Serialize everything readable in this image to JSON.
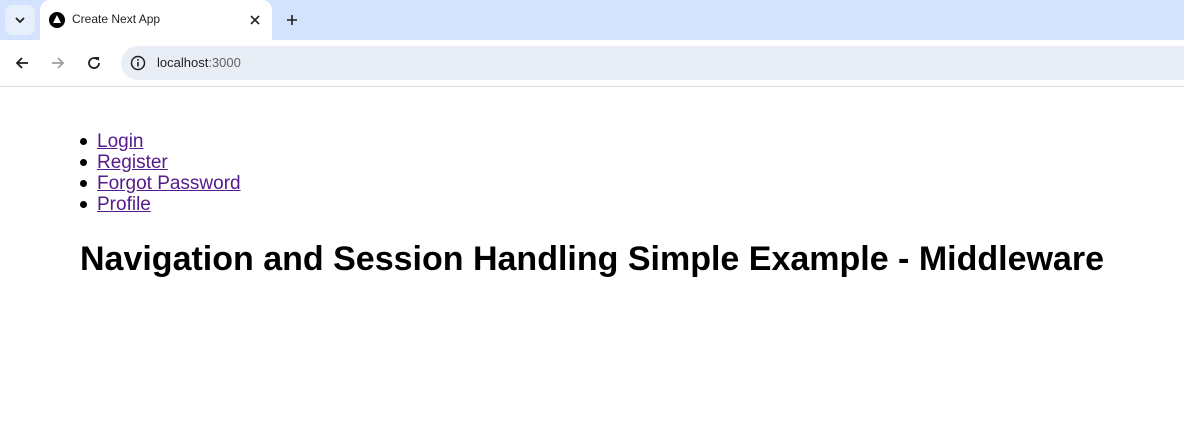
{
  "browser": {
    "tab": {
      "title": "Create Next App"
    },
    "address_bar": {
      "host": "localhost",
      "port": ":3000"
    }
  },
  "page": {
    "nav_links": [
      {
        "label": "Login"
      },
      {
        "label": "Register"
      },
      {
        "label": "Forgot Password"
      },
      {
        "label": "Profile"
      }
    ],
    "title": "Navigation and Session Handling Simple Example - Middleware"
  },
  "icons": {
    "tab_search": "chevron-down-icon",
    "favicon": "nextjs-favicon-icon",
    "tab_close": "close-icon",
    "new_tab": "plus-icon",
    "back": "arrow-left-icon",
    "forward": "arrow-right-icon",
    "reload": "reload-icon",
    "site_info": "info-icon"
  },
  "colors": {
    "tabbar_bg": "#d3e3fd",
    "omnibox_bg": "#e9eef6",
    "visited_link": "#551a8b"
  }
}
